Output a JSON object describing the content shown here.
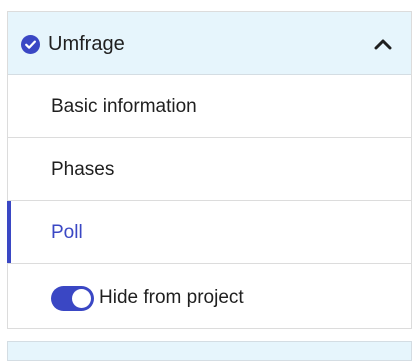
{
  "section": {
    "title": "Umfrage",
    "status_icon": "check-circle-icon",
    "collapse_icon": "chevron-up-icon",
    "accent_color": "#3a47c4",
    "header_bg": "#e6f5fc"
  },
  "nav": {
    "items": [
      {
        "label": "Basic information",
        "active": false
      },
      {
        "label": "Phases",
        "active": false
      },
      {
        "label": "Poll",
        "active": true
      }
    ]
  },
  "toggle": {
    "label": "Hide from project",
    "checked": true
  }
}
